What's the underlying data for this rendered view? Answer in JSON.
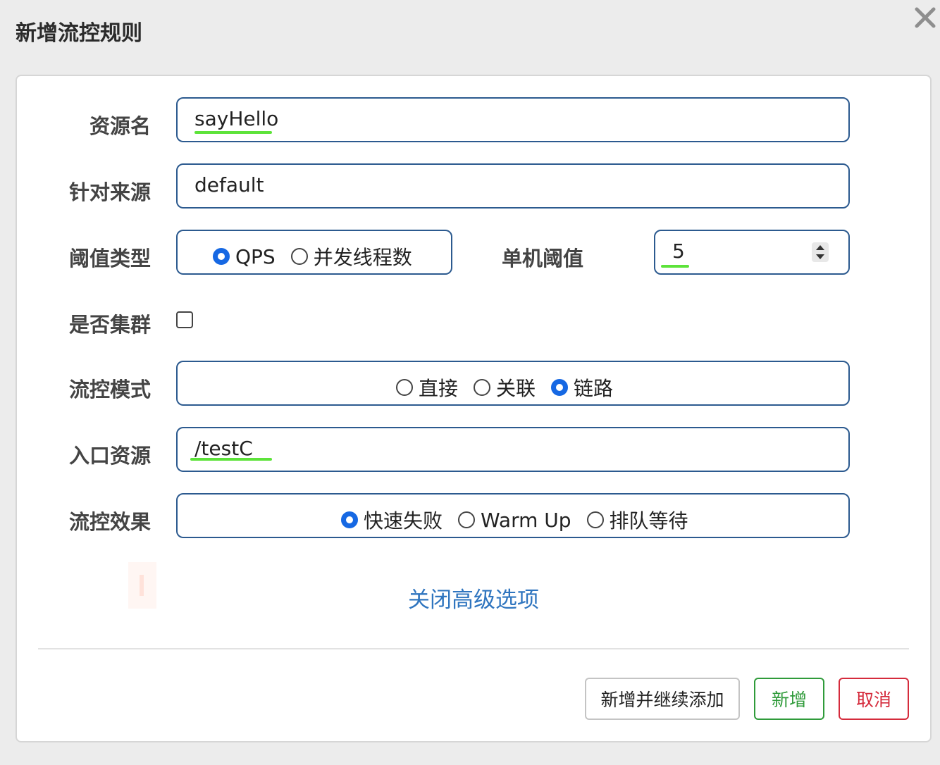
{
  "dialog": {
    "title": "新增流控规则"
  },
  "form": {
    "resource_name": {
      "label": "资源名",
      "value": "sayHello"
    },
    "limit_app": {
      "label": "针对来源",
      "value": "default"
    },
    "threshold_type": {
      "label": "阈值类型",
      "options": [
        "QPS",
        "并发线程数"
      ],
      "selected": "QPS"
    },
    "single_threshold": {
      "label": "单机阈值",
      "value": "5"
    },
    "cluster_mode": {
      "label": "是否集群",
      "checked": false
    },
    "control_mode": {
      "label": "流控模式",
      "options": [
        "直接",
        "关联",
        "链路"
      ],
      "selected": "链路"
    },
    "entry_resource": {
      "label": "入口资源",
      "value": "/testC"
    },
    "control_effect": {
      "label": "流控效果",
      "options": [
        "快速失败",
        "Warm Up",
        "排队等待"
      ],
      "selected": "快速失败"
    },
    "advanced_toggle": "关闭高级选项"
  },
  "buttons": {
    "add_continue": "新增并继续添加",
    "add": "新增",
    "cancel": "取消"
  },
  "colors": {
    "accent": "#1668e3",
    "link": "#2f75bf",
    "success": "#2f9b3a",
    "danger": "#d52b3c",
    "highlight": "#5de33a",
    "input_border": "#2c5a8f"
  }
}
